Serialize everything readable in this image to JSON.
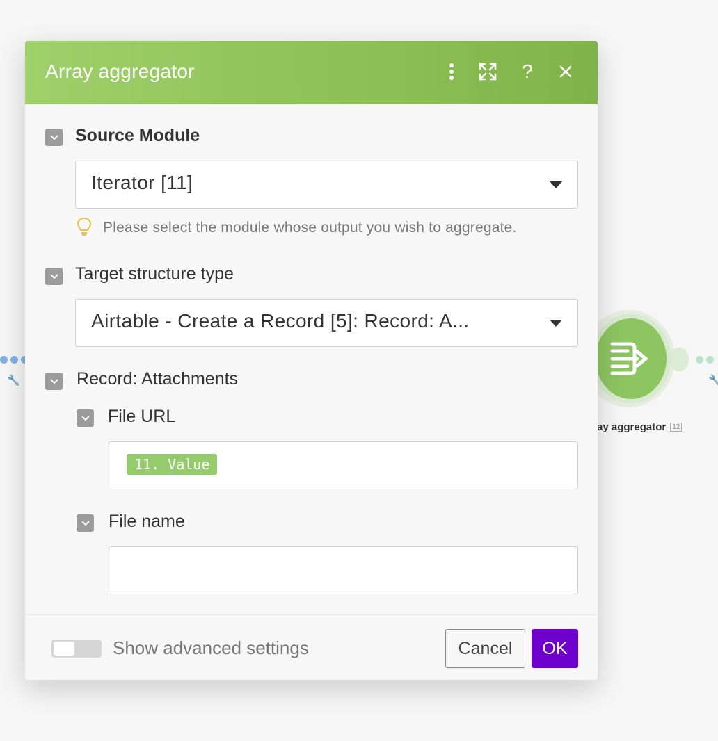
{
  "dialog": {
    "title": "Array aggregator",
    "header_icons": [
      "more-vertical-icon",
      "expand-icon",
      "help-icon",
      "close-icon"
    ],
    "header_gradient": [
      "#9fd06b",
      "#80b44a"
    ]
  },
  "source_module": {
    "label": "Source Module",
    "value": "Iterator [11]",
    "hint": "Please select the module whose output you wish to aggregate."
  },
  "target_structure": {
    "label": "Target structure type",
    "value": "Airtable - Create a Record [5]: Record: A..."
  },
  "record_attachments": {
    "label": "Record: Attachments",
    "file_url": {
      "label": "File URL",
      "token": "11. Value"
    },
    "file_name": {
      "label": "File name",
      "value": ""
    }
  },
  "footer": {
    "advanced_toggle_label": "Show advanced settings",
    "advanced_enabled": false,
    "cancel_label": "Cancel",
    "ok_label": "OK",
    "ok_color": "#6d00cc"
  },
  "canvas": {
    "module_label": "ay aggregator",
    "module_badge": "12",
    "module_color": "#8dc561"
  }
}
